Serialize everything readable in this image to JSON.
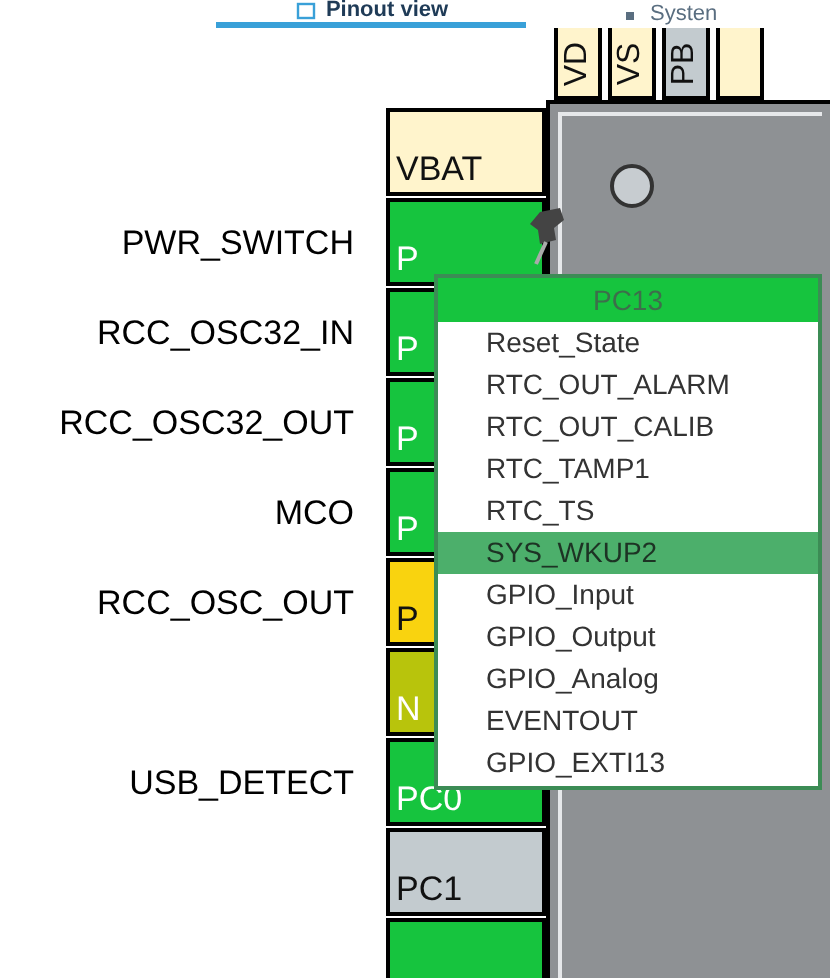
{
  "tabs": [
    {
      "label": "Pinout view",
      "selected": true
    },
    {
      "label": "Systen",
      "selected": false
    }
  ],
  "top_pins": [
    {
      "name": "VD",
      "color": "#fff4cc"
    },
    {
      "name": "VS",
      "color": "#fff4cc"
    },
    {
      "name": "PB",
      "color": "#c3cbcf"
    },
    {
      "color": "#fff4cc"
    }
  ],
  "pins": [
    {
      "name": "VBAT",
      "color": "#fff4cc"
    },
    {
      "name": "P",
      "signal": "PWR_SWITCH",
      "color": "#16c43e"
    },
    {
      "name": "P",
      "signal": "RCC_OSC32_IN",
      "color": "#16c43e"
    },
    {
      "name": "P",
      "signal": "RCC_OSC32_OUT",
      "color": "#16c43e"
    },
    {
      "name": "P",
      "signal": "MCO",
      "color": "#16c43e"
    },
    {
      "name": "P",
      "signal": "RCC_OSC_OUT",
      "color": "#f9d30f"
    },
    {
      "name": "N",
      "color": "#b8c40c"
    },
    {
      "name": "PC0",
      "signal": "USB_DETECT",
      "color": "#16c43e"
    },
    {
      "name": "PC1",
      "color": "#c3cbcf"
    },
    {
      "color": "#16c43e"
    }
  ],
  "menu": {
    "title": "PC13",
    "items": [
      {
        "label": "Reset_State",
        "selected": false
      },
      {
        "label": "RTC_OUT_ALARM",
        "selected": false
      },
      {
        "label": "RTC_OUT_CALIB",
        "selected": false
      },
      {
        "label": "RTC_TAMP1",
        "selected": false
      },
      {
        "label": "RTC_TS",
        "selected": false
      },
      {
        "label": "SYS_WKUP2",
        "selected": true
      },
      {
        "label": "GPIO_Input",
        "selected": false
      },
      {
        "label": "GPIO_Output",
        "selected": false
      },
      {
        "label": "GPIO_Analog",
        "selected": false
      },
      {
        "label": "EVENTOUT",
        "selected": false
      },
      {
        "label": "GPIO_EXTI13",
        "selected": false
      }
    ]
  }
}
